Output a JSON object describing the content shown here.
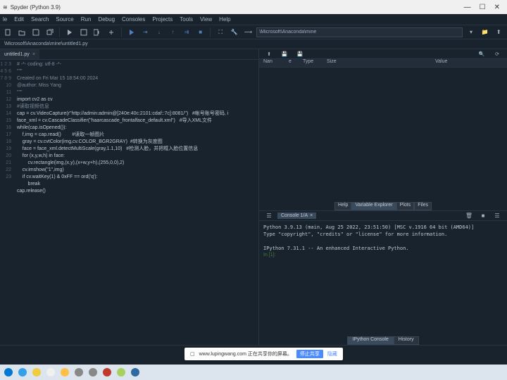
{
  "titlebar": {
    "app_title": "Spyder (Python 3.9)"
  },
  "menu": [
    "le",
    "Edit",
    "Search",
    "Source",
    "Run",
    "Debug",
    "Consoles",
    "Projects",
    "Tools",
    "View",
    "Help"
  ],
  "working_dir": "\\Microsoft\\Anaconda\\mine",
  "editor": {
    "filepath": "\\Microsoft\\Anaconda\\mine\\untitled1.py",
    "tab_name": "untitled1.py",
    "line_numbers": [
      "1",
      "2",
      "3",
      "4",
      "5",
      "6",
      "7",
      "8",
      "9",
      "10",
      "11",
      "12",
      "13",
      "14",
      "15",
      "16",
      "17",
      "18",
      "19",
      "20",
      "21",
      "22",
      "23"
    ],
    "lines": [
      {
        "t": "comment",
        "v": "# -*- coding: utf-8 -*-"
      },
      {
        "t": "comment",
        "v": "\"\"\""
      },
      {
        "t": "comment",
        "v": "Created on Fri Mar 15 18:54:00 2024"
      },
      {
        "t": "plain",
        "v": ""
      },
      {
        "t": "comment",
        "v": "@author: Miss Yang"
      },
      {
        "t": "comment",
        "v": "\"\"\""
      },
      {
        "t": "code",
        "v": "import cv2 as cv"
      },
      {
        "t": "comment",
        "v": "#读取视频信息"
      },
      {
        "t": "mixed",
        "v": "cap = cv.VideoCapture(r\"http://admin:admin@[240e:40c:2101:cdaf::7c]:8081/\")   #帐号账号密码, i"
      },
      {
        "t": "mixed",
        "v": "face_xml = cv.CascadeClassifier(\"haarcascade_frontalface_default.xml\")   #导入XML文件"
      },
      {
        "t": "code",
        "v": "while(cap.isOpened()):"
      },
      {
        "t": "mixed",
        "v": "    f,img = cap.read()        #读取一帧图片"
      },
      {
        "t": "mixed",
        "v": "    gray = cv.cvtColor(img,cv.COLOR_BGR2GRAY)  #转换为灰度图"
      },
      {
        "t": "mixed",
        "v": "    face = face_xml.detectMultiScale(gray,1.1,10)   #检测人脸，并把框入脸位置信息"
      },
      {
        "t": "plain",
        "v": ""
      },
      {
        "t": "code",
        "v": "    for (x,y,w,h) in face:"
      },
      {
        "t": "code",
        "v": "        cv.rectangle(img,(x,y),(x+w,y+h),(255,0,0),2)"
      },
      {
        "t": "code",
        "v": "    cv.imshow(\"1\",img)"
      },
      {
        "t": "code",
        "v": "    if cv.waitKey(1) & 0xFF == ord('q'):"
      },
      {
        "t": "code",
        "v": "        break"
      },
      {
        "t": "plain",
        "v": ""
      },
      {
        "t": "code",
        "v": "cap.release()"
      },
      {
        "t": "plain",
        "v": ""
      }
    ]
  },
  "var_explorer": {
    "col_name": "Nan",
    "col_type1": "e",
    "col_type": "Type",
    "col_size": "Size",
    "col_value": "Value",
    "tabs": [
      "Help",
      "Variable Explorer",
      "Plots",
      "Files"
    ],
    "active_tab": 1
  },
  "console": {
    "tab_name": "Console 1/A",
    "lines": [
      "Python 3.9.13 (main, Aug 25 2022, 23:51:50) [MSC v.1916 64 bit (AMD64)]",
      "Type \"copyright\", \"credits\" or \"license\" for more information.",
      "",
      "IPython 7.31.1 -- An enhanced Interactive Python.",
      ""
    ],
    "prompt": "In [1]:",
    "tabs": [
      "IPython Console",
      "History"
    ],
    "active_tab": 0
  },
  "notification": {
    "text": "www.lupingwang.com 正在共享你的屏幕。",
    "stop": "停止共享",
    "hide": "隐藏"
  },
  "taskbar_colors": [
    "#0078d4",
    "#35a0e8",
    "#f0cc40",
    "#f0f0f0",
    "#ffc048",
    "#888",
    "#888",
    "#c0392b",
    "#a8d060",
    "#2c6aa0"
  ]
}
